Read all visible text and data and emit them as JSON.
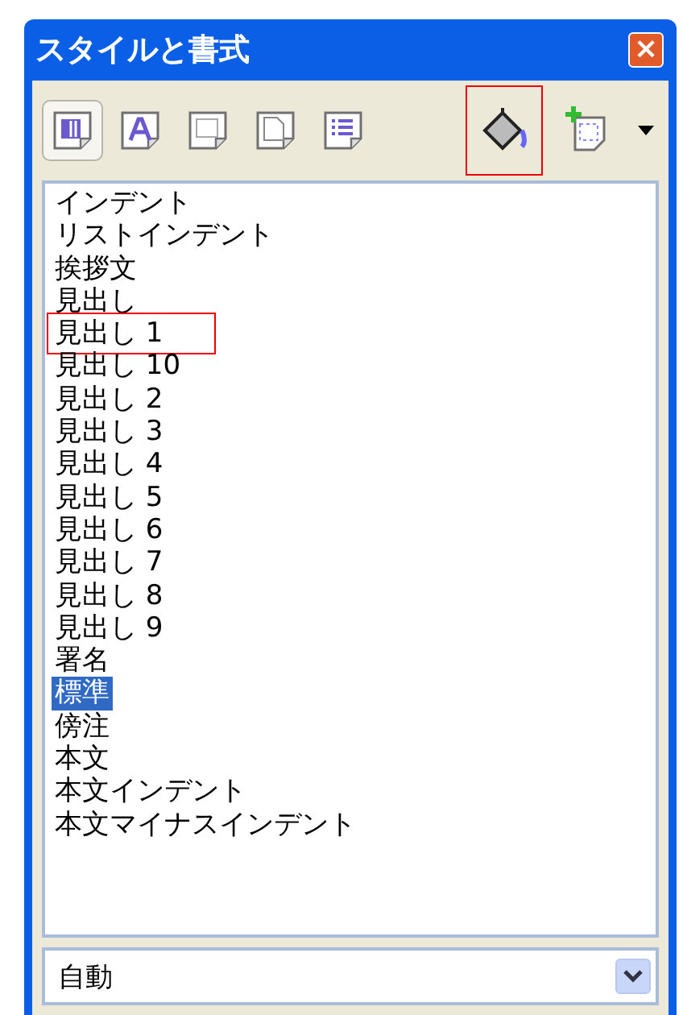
{
  "window": {
    "title": "スタイルと書式",
    "close_label": "×"
  },
  "toolbar": {
    "families": [
      {
        "kind": "paragraph",
        "selected": true
      },
      {
        "kind": "character",
        "selected": false
      },
      {
        "kind": "frame",
        "selected": false
      },
      {
        "kind": "page",
        "selected": false
      },
      {
        "kind": "list",
        "selected": false
      }
    ],
    "actions": [
      {
        "kind": "fill",
        "highlighted": true
      },
      {
        "kind": "new",
        "highlighted": false
      }
    ]
  },
  "styles": [
    {
      "label": "インデント",
      "selected": false,
      "highlighted": false
    },
    {
      "label": "リストインデント",
      "selected": false,
      "highlighted": false
    },
    {
      "label": "挨拶文",
      "selected": false,
      "highlighted": false
    },
    {
      "label": "見出し",
      "selected": false,
      "highlighted": false
    },
    {
      "label": "見出し 1",
      "selected": false,
      "highlighted": true
    },
    {
      "label": "見出し 10",
      "selected": false,
      "highlighted": false
    },
    {
      "label": "見出し 2",
      "selected": false,
      "highlighted": false
    },
    {
      "label": "見出し 3",
      "selected": false,
      "highlighted": false
    },
    {
      "label": "見出し 4",
      "selected": false,
      "highlighted": false
    },
    {
      "label": "見出し 5",
      "selected": false,
      "highlighted": false
    },
    {
      "label": "見出し 6",
      "selected": false,
      "highlighted": false
    },
    {
      "label": "見出し 7",
      "selected": false,
      "highlighted": false
    },
    {
      "label": "見出し 8",
      "selected": false,
      "highlighted": false
    },
    {
      "label": "見出し 9",
      "selected": false,
      "highlighted": false
    },
    {
      "label": "署名",
      "selected": false,
      "highlighted": false
    },
    {
      "label": "標準",
      "selected": true,
      "highlighted": false
    },
    {
      "label": "傍注",
      "selected": false,
      "highlighted": false
    },
    {
      "label": "本文",
      "selected": false,
      "highlighted": false
    },
    {
      "label": "本文インデント",
      "selected": false,
      "highlighted": false
    },
    {
      "label": "本文マイナスインデント",
      "selected": false,
      "highlighted": false
    }
  ],
  "filter": {
    "value": "自動"
  }
}
